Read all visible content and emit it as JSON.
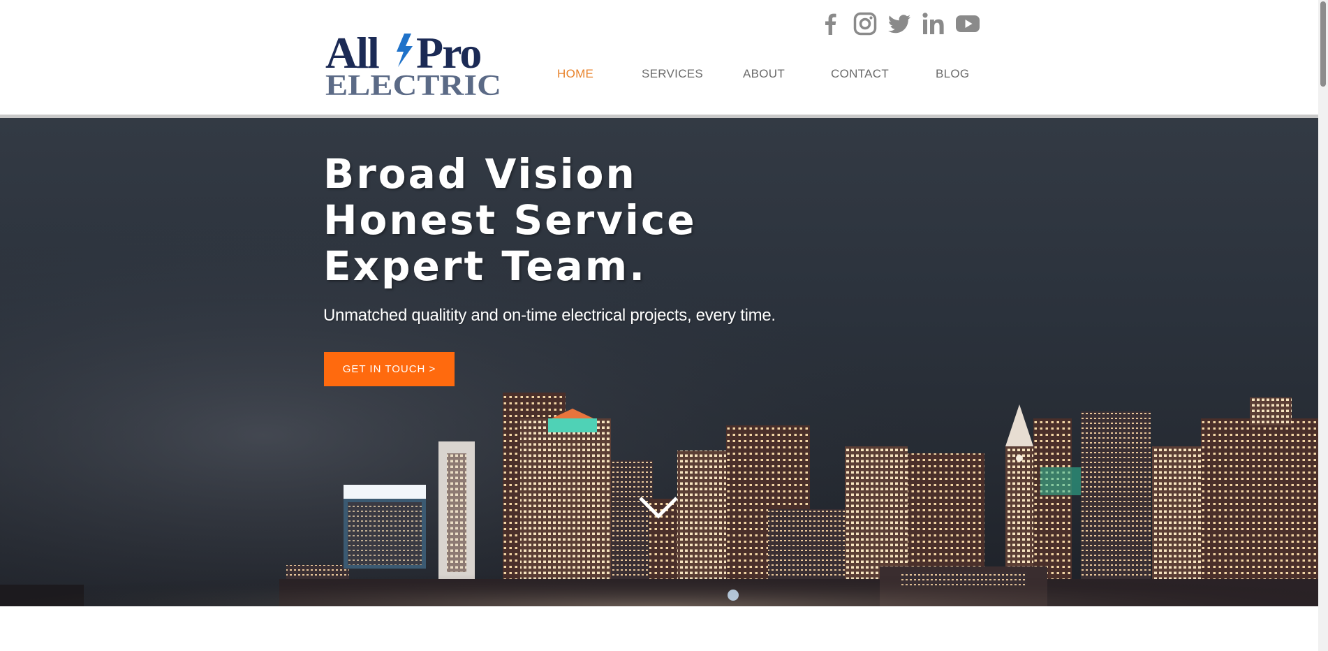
{
  "logo": {
    "line1_left": "All",
    "line1_right": "Pro",
    "line2": "ELECTRIC"
  },
  "social": [
    {
      "icon": "facebook-icon",
      "label": "Facebook"
    },
    {
      "icon": "instagram-icon",
      "label": "Instagram"
    },
    {
      "icon": "twitter-icon",
      "label": "Twitter"
    },
    {
      "icon": "linkedin-icon",
      "label": "LinkedIn"
    },
    {
      "icon": "youtube-icon",
      "label": "YouTube"
    }
  ],
  "nav": {
    "items": [
      {
        "label": "HOME",
        "active": true
      },
      {
        "label": "SERVICES",
        "active": false
      },
      {
        "label": "ABOUT",
        "active": false
      },
      {
        "label": "CONTACT",
        "active": false
      },
      {
        "label": "BLOG",
        "active": false
      }
    ]
  },
  "hero": {
    "title_lines": [
      "Broad Vision",
      "Honest Service",
      "Expert Team."
    ],
    "subtitle": "Unmatched qualitity and on-time electrical projects, every time.",
    "cta_label": "GET IN TOUCH >"
  },
  "colors": {
    "accent": "#ff6a0e",
    "nav_active": "#e8822a",
    "nav_text": "#6b6b6b",
    "logo_navy": "#1b2a55",
    "logo_slate": "#5b6a86",
    "logo_bolt": "#1f72c9",
    "social_icon": "#8a8a8a"
  }
}
